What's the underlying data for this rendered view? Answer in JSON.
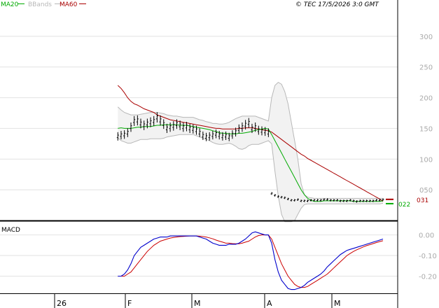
{
  "stamp": "© TEC 17/5/2026 3:0 GMT",
  "legend": [
    {
      "label": "MA20",
      "color": "#00aa00"
    },
    {
      "label": "BBands",
      "color": "#b8b8b8"
    },
    {
      "label": "MA60",
      "color": "#aa0000"
    }
  ],
  "colors": {
    "price": "#000000",
    "ma20": "#00aa00",
    "ma60": "#aa0000",
    "bbands": "#b8b8b8",
    "macd": "#0000cc",
    "signal": "#cc0000"
  },
  "chart_data": [
    {
      "type": "line",
      "panel": "price",
      "ylim": [
        0,
        350
      ],
      "yticks": [
        {
          "v": 50,
          "label": "050"
        },
        {
          "v": 100,
          "label": "100"
        },
        {
          "v": 150,
          "label": "150"
        },
        {
          "v": 200,
          "label": "200"
        },
        {
          "v": 250,
          "label": "250"
        },
        {
          "v": 300,
          "label": "300"
        }
      ],
      "x_labels": [
        {
          "i": 52,
          "label": "26"
        },
        {
          "i": 72,
          "label": "F"
        },
        {
          "i": 91,
          "label": "M"
        },
        {
          "i": 112,
          "label": "A"
        },
        {
          "i": 131,
          "label": "M"
        }
      ],
      "last_values": {
        "ma60": "031",
        "ma20": "022"
      },
      "series": [
        {
          "key": "price",
          "start": 36,
          "values": [
            137,
            139,
            140,
            143,
            152,
            162,
            163,
            158,
            155,
            158,
            160,
            162,
            168,
            163,
            157,
            150,
            152,
            154,
            157,
            155,
            152,
            153,
            150,
            149,
            147,
            143,
            138,
            136,
            137,
            139,
            141,
            139,
            137,
            138,
            136,
            140,
            144,
            149,
            152,
            156,
            159,
            150,
            152,
            147,
            146,
            145,
            143,
            44,
            41,
            39,
            38,
            37,
            35,
            33,
            33,
            34,
            32,
            32,
            32,
            33,
            33,
            33,
            33,
            34,
            34,
            33,
            33,
            33,
            32,
            32,
            32,
            33,
            32,
            31,
            32,
            32,
            32,
            32,
            32,
            33,
            33,
            34
          ]
        },
        {
          "key": "ma20",
          "start": 36,
          "values": [
            150,
            151,
            150,
            150,
            150,
            151,
            152,
            152,
            153,
            153,
            153,
            154,
            155,
            155,
            156,
            156,
            156,
            156,
            156,
            155,
            155,
            155,
            154,
            153,
            152,
            151,
            150,
            149,
            148,
            146,
            145,
            143,
            142,
            142,
            141,
            141,
            141,
            142,
            142,
            143,
            144,
            145,
            147,
            148,
            149,
            150,
            149,
            140,
            130,
            120,
            110,
            100,
            90,
            80,
            70,
            60,
            50,
            42,
            36,
            33,
            31,
            31,
            31,
            32,
            32,
            32,
            32,
            32,
            32,
            32,
            32,
            32,
            31,
            31,
            31,
            31,
            31,
            31,
            31,
            31,
            31,
            32
          ]
        },
        {
          "key": "ma60",
          "start": 36,
          "values": [
            220,
            215,
            208,
            200,
            194,
            190,
            188,
            185,
            182,
            180,
            178,
            176,
            172,
            170,
            168,
            166,
            164,
            163,
            162,
            161,
            160,
            159,
            158,
            157,
            156,
            155,
            154,
            153,
            152,
            151,
            150,
            150,
            149,
            149,
            149,
            149,
            149,
            150,
            150,
            151,
            151,
            151,
            150,
            149,
            148,
            147,
            146,
            144,
            140,
            136,
            132,
            128,
            124,
            120,
            116,
            112,
            108,
            105,
            101,
            98,
            95,
            92,
            89,
            86,
            83,
            80,
            77,
            74,
            71,
            68,
            65,
            62,
            59,
            56,
            53,
            50,
            47,
            44,
            41,
            38,
            35,
            31
          ]
        },
        {
          "key": "bb_upper",
          "start": 36,
          "values": [
            185,
            180,
            176,
            174,
            172,
            172,
            172,
            173,
            174,
            175,
            176,
            176,
            176,
            175,
            174,
            172,
            171,
            170,
            170,
            169,
            168,
            168,
            168,
            168,
            166,
            164,
            163,
            161,
            160,
            158,
            158,
            157,
            157,
            158,
            160,
            163,
            166,
            168,
            170,
            170,
            170,
            170,
            170,
            168,
            166,
            164,
            162,
            200,
            220,
            225,
            222,
            210,
            190,
            160,
            130,
            100,
            60,
            42,
            38,
            37,
            36,
            36,
            36,
            36,
            36,
            36,
            36,
            36,
            36,
            36,
            36,
            36,
            36,
            36,
            36,
            36,
            36,
            36,
            36,
            36,
            36,
            36
          ]
        },
        {
          "key": "bb_lower",
          "start": 36,
          "values": [
            135,
            130,
            128,
            126,
            126,
            128,
            130,
            132,
            132,
            132,
            133,
            133,
            133,
            133,
            134,
            136,
            137,
            138,
            139,
            140,
            140,
            140,
            140,
            140,
            138,
            136,
            134,
            132,
            130,
            127,
            125,
            124,
            124,
            125,
            126,
            124,
            121,
            117,
            116,
            118,
            122,
            124,
            124,
            124,
            126,
            128,
            130,
            125,
            80,
            40,
            10,
            -10,
            -15,
            -10,
            0,
            10,
            20,
            26,
            27,
            27,
            27,
            27,
            27,
            27,
            27,
            27,
            27,
            27,
            27,
            27,
            27,
            27,
            27,
            27,
            27,
            27,
            27,
            27,
            27,
            27,
            27,
            28
          ]
        }
      ]
    },
    {
      "type": "line",
      "panel": "macd",
      "title": "MACD",
      "ylim": [
        -0.28,
        0.06
      ],
      "yticks": [
        {
          "v": 0.0,
          "label": "0.00"
        },
        {
          "v": -0.1,
          "label": "-0.10"
        },
        {
          "v": -0.2,
          "label": "-0.20"
        }
      ],
      "series": [
        {
          "key": "macd",
          "start": 36,
          "values": [
            -0.2,
            -0.2,
            -0.19,
            -0.17,
            -0.14,
            -0.1,
            -0.08,
            -0.06,
            -0.05,
            -0.04,
            -0.03,
            -0.02,
            -0.015,
            -0.01,
            -0.01,
            -0.01,
            -0.005,
            -0.005,
            -0.005,
            -0.005,
            -0.005,
            -0.005,
            -0.005,
            -0.005,
            -0.005,
            -0.01,
            -0.015,
            -0.02,
            -0.03,
            -0.04,
            -0.045,
            -0.05,
            -0.05,
            -0.05,
            -0.045,
            -0.045,
            -0.045,
            -0.04,
            -0.03,
            -0.02,
            -0.005,
            0.01,
            0.015,
            0.01,
            0.005,
            0.0,
            0.0,
            -0.04,
            -0.12,
            -0.18,
            -0.22,
            -0.24,
            -0.26,
            -0.265,
            -0.265,
            -0.26,
            -0.255,
            -0.245,
            -0.23,
            -0.22,
            -0.21,
            -0.2,
            -0.19,
            -0.175,
            -0.155,
            -0.14,
            -0.125,
            -0.11,
            -0.095,
            -0.085,
            -0.075,
            -0.07,
            -0.065,
            -0.06,
            -0.055,
            -0.05,
            -0.045,
            -0.04,
            -0.035,
            -0.03,
            -0.025,
            -0.02
          ]
        },
        {
          "key": "signal",
          "start": 36,
          "values": [
            -0.2,
            -0.2,
            -0.2,
            -0.19,
            -0.18,
            -0.16,
            -0.14,
            -0.12,
            -0.1,
            -0.08,
            -0.065,
            -0.05,
            -0.04,
            -0.03,
            -0.025,
            -0.02,
            -0.015,
            -0.012,
            -0.01,
            -0.008,
            -0.007,
            -0.006,
            -0.005,
            -0.005,
            -0.005,
            -0.006,
            -0.008,
            -0.01,
            -0.014,
            -0.019,
            -0.025,
            -0.03,
            -0.035,
            -0.04,
            -0.04,
            -0.042,
            -0.043,
            -0.043,
            -0.04,
            -0.035,
            -0.03,
            -0.02,
            -0.01,
            -0.003,
            0.0,
            0.0,
            0.0,
            -0.02,
            -0.06,
            -0.1,
            -0.14,
            -0.17,
            -0.2,
            -0.22,
            -0.24,
            -0.25,
            -0.255,
            -0.255,
            -0.25,
            -0.24,
            -0.23,
            -0.22,
            -0.21,
            -0.2,
            -0.19,
            -0.175,
            -0.16,
            -0.145,
            -0.13,
            -0.115,
            -0.1,
            -0.09,
            -0.08,
            -0.072,
            -0.065,
            -0.058,
            -0.052,
            -0.047,
            -0.042,
            -0.037,
            -0.032,
            -0.028
          ]
        }
      ]
    }
  ]
}
